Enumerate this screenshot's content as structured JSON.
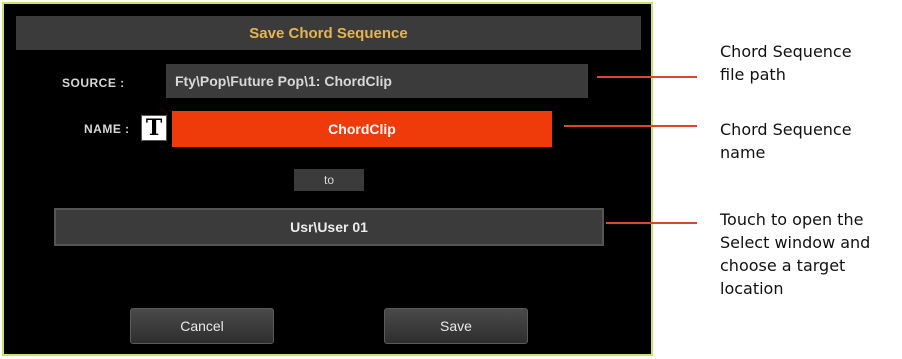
{
  "dialog": {
    "title": "Save Chord Sequence",
    "source_label": "SOURCE :",
    "source_path": "Fty\\Pop\\Future Pop\\1: ChordClip",
    "name_label": "NAME :",
    "text_edit_glyph": "T",
    "name_value": "ChordClip",
    "to_label": "to",
    "target_path": "Usr\\User 01",
    "cancel_label": "Cancel",
    "save_label": "Save"
  },
  "callouts": [
    {
      "text": "Chord Sequence\nfile path"
    },
    {
      "text": "Chord Sequence\nname"
    },
    {
      "text": "Touch to open the\nSelect window and\nchoose a target\nlocation"
    }
  ],
  "colors": {
    "title_text": "#e7b44e",
    "name_field": "#ef3a0a",
    "dialog_border": "#c9e36a",
    "callout_line": "#e0442c"
  },
  "icons": {
    "text_edit": "text-edit-icon"
  }
}
